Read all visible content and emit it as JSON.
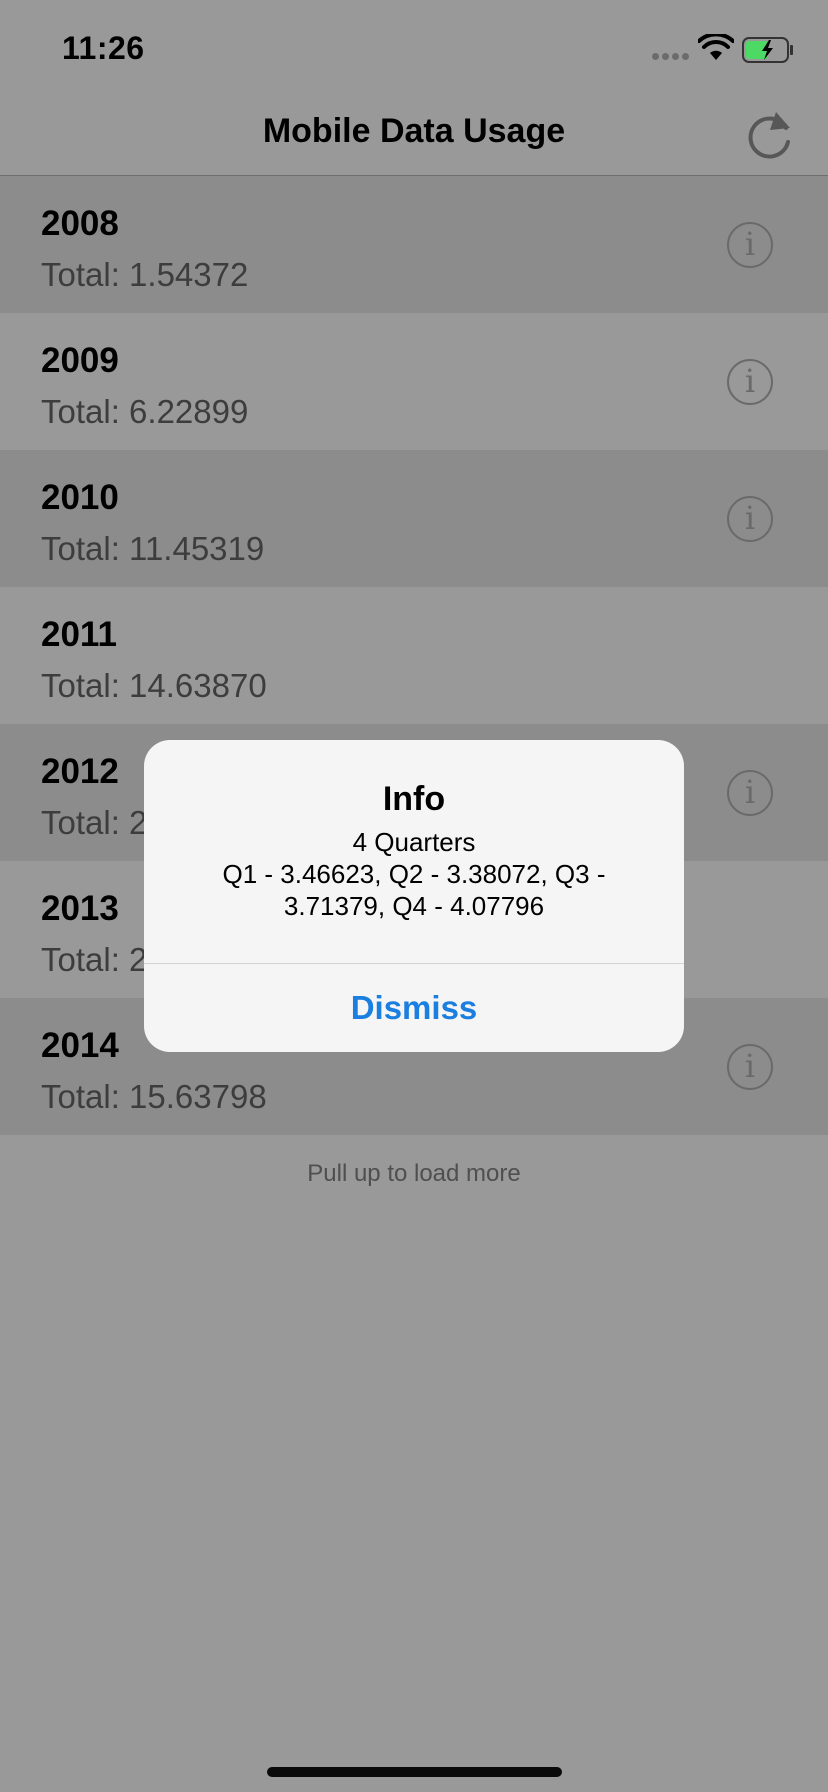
{
  "status_bar": {
    "time": "11:26"
  },
  "nav": {
    "title": "Mobile Data Usage",
    "refresh_icon": "refresh-icon"
  },
  "rows": [
    {
      "year": "2008",
      "total": "Total: 1.54372",
      "has_info": true
    },
    {
      "year": "2009",
      "total": "Total: 6.22899",
      "has_info": true
    },
    {
      "year": "2010",
      "total": "Total: 11.45319",
      "has_info": true
    },
    {
      "year": "2011",
      "total": "Total: 14.63870",
      "has_info": false
    },
    {
      "year": "2012",
      "total": "Total: 2",
      "has_info": true
    },
    {
      "year": "2013",
      "total": "Total: 2",
      "has_info": false
    },
    {
      "year": "2014",
      "total": "Total: 15.63798",
      "has_info": true
    }
  ],
  "info_icon_glyph": "i",
  "footer": {
    "text": "Pull up to load more"
  },
  "alert": {
    "title": "Info",
    "message_line1": "4 Quarters",
    "message_line2": "Q1 - 3.46623, Q2 - 3.38072, Q3 - 3.71379, Q4 - 4.07796",
    "dismiss_label": "Dismiss"
  },
  "colors": {
    "accent": "#1a7fe0",
    "row_dark": "#8c8c8c",
    "row_light": "#999999",
    "battery_fill": "#4cd964"
  }
}
